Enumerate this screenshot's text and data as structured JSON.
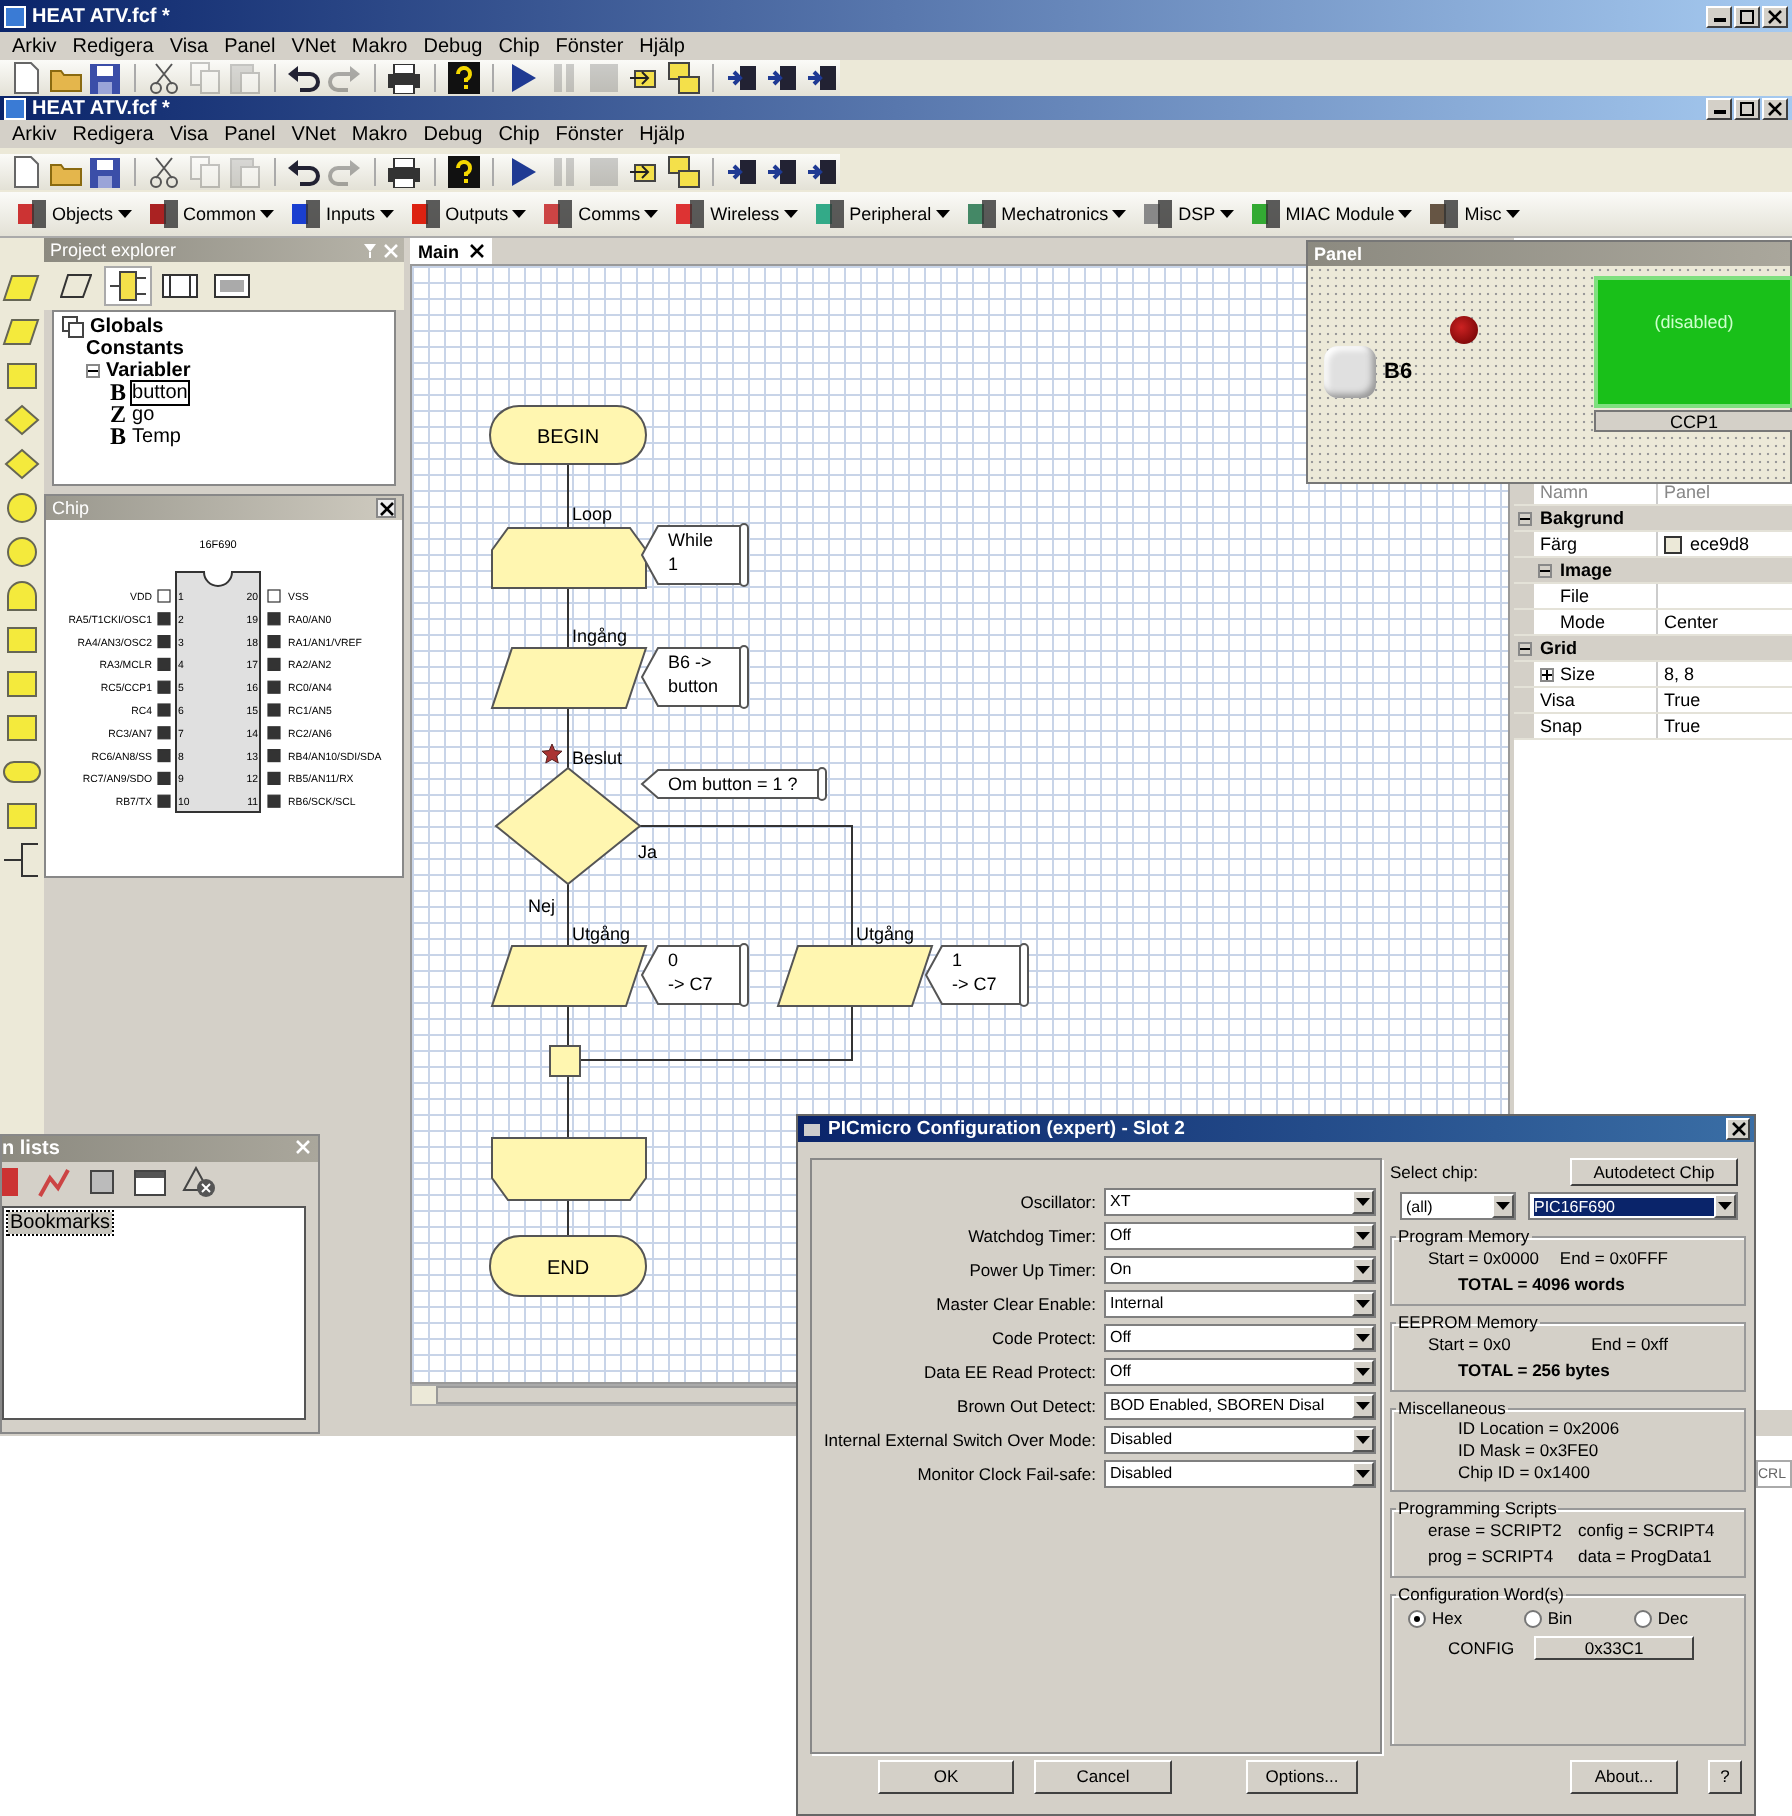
{
  "outer_window": {
    "title": "HEAT ATV.fcf *",
    "menu": [
      "Arkiv",
      "Redigera",
      "Visa",
      "Panel",
      "VNet",
      "Makro",
      "Debug",
      "Chip",
      "Fönster",
      "Hjälp"
    ],
    "toolbar": [
      [
        {
          "kind": "new",
          "disabled": false
        },
        {
          "kind": "open",
          "disabled": false
        },
        {
          "kind": "save",
          "disabled": false
        }
      ],
      [
        {
          "kind": "cut",
          "disabled": false
        },
        {
          "kind": "copy",
          "disabled": true
        },
        {
          "kind": "paste",
          "disabled": true
        }
      ],
      [
        {
          "kind": "undo",
          "disabled": false
        },
        {
          "kind": "redo",
          "disabled": true
        }
      ],
      [
        {
          "kind": "print",
          "disabled": false
        }
      ],
      [
        {
          "kind": "help",
          "disabled": false
        }
      ],
      [
        {
          "kind": "play",
          "disabled": false
        },
        {
          "kind": "pause",
          "disabled": true
        },
        {
          "kind": "stop",
          "disabled": true
        },
        {
          "kind": "step_into",
          "disabled": false
        },
        {
          "kind": "step_over",
          "disabled": false
        }
      ],
      [
        {
          "kind": "chip",
          "disabled": false
        },
        {
          "kind": "chip",
          "disabled": false
        },
        {
          "kind": "chip",
          "disabled": false
        }
      ]
    ]
  },
  "inner_window": {
    "title": "HEAT ATV.fcf *",
    "menu": [
      "Arkiv",
      "Redigera",
      "Visa",
      "Panel",
      "VNet",
      "Makro",
      "Debug",
      "Chip",
      "Fönster",
      "Hjälp"
    ],
    "toolbar": [
      [
        {
          "kind": "new",
          "disabled": false
        },
        {
          "kind": "open",
          "disabled": false
        },
        {
          "kind": "save",
          "disabled": false
        }
      ],
      [
        {
          "kind": "cut",
          "disabled": false
        },
        {
          "kind": "copy",
          "disabled": true
        },
        {
          "kind": "paste",
          "disabled": true
        }
      ],
      [
        {
          "kind": "undo",
          "disabled": false
        },
        {
          "kind": "redo",
          "disabled": true
        }
      ],
      [
        {
          "kind": "print",
          "disabled": false
        }
      ],
      [
        {
          "kind": "help",
          "disabled": false
        }
      ],
      [
        {
          "kind": "play",
          "disabled": false
        },
        {
          "kind": "pause",
          "disabled": true
        },
        {
          "kind": "stop",
          "disabled": true
        },
        {
          "kind": "step_into",
          "disabled": false
        },
        {
          "kind": "step_over",
          "disabled": false
        }
      ],
      [
        {
          "kind": "chip",
          "disabled": false
        },
        {
          "kind": "chip",
          "disabled": false
        },
        {
          "kind": "chip",
          "disabled": false
        }
      ]
    ],
    "component_toolbar": [
      "Objects",
      "Common",
      "Inputs",
      "Outputs",
      "Comms",
      "Wireless",
      "Peripheral",
      "Mechatronics",
      "DSP",
      "MIAC Module",
      "Misc"
    ]
  },
  "project_explorer": {
    "title": "Project explorer",
    "tabs": [
      {
        "kind": "io",
        "selected": false
      },
      {
        "kind": "variables",
        "selected": true
      },
      {
        "kind": "macros",
        "selected": false
      },
      {
        "kind": "components",
        "selected": false
      }
    ],
    "tree": [
      {
        "label": "Globals",
        "children": [
          {
            "label": "Constants"
          },
          {
            "label": "Variabler",
            "expanded": true,
            "children": [
              {
                "type": "B",
                "label": "button",
                "selected": true
              },
              {
                "type": "Z",
                "label": "go",
                "selected": false
              },
              {
                "type": "B",
                "label": "Temp",
                "selected": false
              }
            ]
          }
        ]
      }
    ]
  },
  "chip": {
    "title": "Chip",
    "part": "16F690",
    "left_pins": [
      {
        "number": "1",
        "label": "VDD",
        "kind": "power"
      },
      {
        "number": "2",
        "label": "RA5/T1CKI/OSC1",
        "kind": "io"
      },
      {
        "number": "3",
        "label": "RA4/AN3/OSC2",
        "kind": "io"
      },
      {
        "number": "4",
        "label": "RA3/MCLR",
        "kind": "io"
      },
      {
        "number": "5",
        "label": "RC5/CCP1",
        "kind": "io"
      },
      {
        "number": "6",
        "label": "RC4",
        "kind": "io"
      },
      {
        "number": "7",
        "label": "RC3/AN7",
        "kind": "io"
      },
      {
        "number": "8",
        "label": "RC6/AN8/SS",
        "kind": "io"
      },
      {
        "number": "9",
        "label": "RC7/AN9/SDO",
        "kind": "io"
      },
      {
        "number": "10",
        "label": "RB7/TX",
        "kind": "io"
      }
    ],
    "right_pins": [
      {
        "number": "20",
        "label": "VSS",
        "kind": "power"
      },
      {
        "number": "19",
        "label": "RA0/AN0",
        "kind": "io"
      },
      {
        "number": "18",
        "label": "RA1/AN1/VREF",
        "kind": "io"
      },
      {
        "number": "17",
        "label": "RA2/AN2",
        "kind": "io"
      },
      {
        "number": "16",
        "label": "RC0/AN4",
        "kind": "io"
      },
      {
        "number": "15",
        "label": "RC1/AN5",
        "kind": "io"
      },
      {
        "number": "14",
        "label": "RC2/AN6",
        "kind": "io"
      },
      {
        "number": "13",
        "label": "RB4/AN10/SDI/SDA",
        "kind": "io"
      },
      {
        "number": "12",
        "label": "RB5/AN11/RX",
        "kind": "io"
      },
      {
        "number": "11",
        "label": "RB6/SCK/SCL",
        "kind": "io"
      }
    ]
  },
  "editor_tabs": [
    {
      "label": "Main",
      "selected": true
    }
  ],
  "flowchart": {
    "nodes": [
      {
        "kind": "terminal",
        "text": "BEGIN"
      },
      {
        "kind": "loop_start",
        "label": "Loop",
        "comment": [
          "While",
          "1"
        ]
      },
      {
        "kind": "input",
        "label": "Ingång",
        "comment": [
          "B6 ->",
          "button"
        ]
      },
      {
        "kind": "decision",
        "label": "Beslut",
        "comment": [
          "Om button = 1 ?"
        ],
        "bookmarked": true,
        "yes_label": "Ja",
        "no_label": "Nej"
      },
      {
        "kind": "output",
        "label": "Utgång",
        "comment": [
          "0",
          "-> C7"
        ]
      },
      {
        "kind": "output",
        "label": "Utgång",
        "comment": [
          "1",
          "-> C7"
        ]
      },
      {
        "kind": "junction"
      },
      {
        "kind": "loop_end"
      },
      {
        "kind": "terminal",
        "text": "END"
      }
    ]
  },
  "panel_window": {
    "title": "Panel",
    "switch_label": "B6",
    "pressed": false,
    "display_text": "(disabled)",
    "display_caption": "CCP1"
  },
  "properties": {
    "columns": [
      "Namn",
      "Panel"
    ],
    "groups": [
      {
        "name": "Bakgrund",
        "expanded": true,
        "children": [
          {
            "name": "Färg",
            "value": "ece9d8"
          },
          {
            "name": "Image",
            "expanded": true,
            "children": [
              {
                "name": "File"
              },
              {
                "name": "Mode",
                "value": "Center"
              }
            ]
          }
        ]
      },
      {
        "name": "Grid",
        "expanded": true,
        "children": [
          {
            "name": "Size",
            "value": "8, 8",
            "expanded": false
          },
          {
            "name": "Visa",
            "value": "True"
          },
          {
            "name": "Snap",
            "value": "True"
          }
        ]
      }
    ]
  },
  "lists_panel": {
    "title": "n lists",
    "items": [
      {
        "label": "Bookmarks",
        "selected": true
      }
    ]
  },
  "status_bar": {
    "indicator": "CRL"
  },
  "dialog": {
    "title": "PICmicro Configuration (expert) - Slot 2",
    "settings": [
      {
        "label": "Oscillator:",
        "value": "XT"
      },
      {
        "label": "Watchdog Timer:",
        "value": "Off"
      },
      {
        "label": "Power Up Timer:",
        "value": "On"
      },
      {
        "label": "Master Clear Enable:",
        "value": "Internal"
      },
      {
        "label": "Code Protect:",
        "value": "Off"
      },
      {
        "label": "Data EE Read Protect:",
        "value": "Off"
      },
      {
        "label": "Brown Out Detect:",
        "value": "BOD Enabled, SBOREN Disal"
      },
      {
        "label": "Internal External Switch Over Mode:",
        "value": "Disabled"
      },
      {
        "label": "Monitor Clock Fail-safe:",
        "value": "Disabled"
      }
    ],
    "select_chip_label": "Select chip:",
    "autodetect_button": "Autodetect Chip",
    "family": "(all)",
    "chip": {
      "value": "PIC16F690",
      "focused": true
    },
    "program_memory": {
      "title": "Program Memory",
      "start": "Start = 0x0000",
      "end": "End = 0x0FFF",
      "total": "TOTAL = 4096 words"
    },
    "eeprom_memory": {
      "title": "EEPROM Memory",
      "start": "Start = 0x0",
      "end": "End = 0xff",
      "total": "TOTAL = 256 bytes"
    },
    "miscellaneous": {
      "title": "Miscellaneous",
      "lines": [
        "ID Location = 0x2006",
        "ID Mask = 0x3FE0",
        "Chip ID = 0x1400"
      ]
    },
    "programming_scripts": {
      "title": "Programming Scripts",
      "entries": [
        "erase = SCRIPT2",
        "config = SCRIPT4",
        "prog = SCRIPT4",
        "data = ProgData1"
      ]
    },
    "configuration_words": {
      "title": "Configuration Word(s)",
      "formats": [
        {
          "label": "Hex",
          "selected": true
        },
        {
          "label": "Bin",
          "selected": false
        },
        {
          "label": "Dec",
          "selected": false
        }
      ],
      "config_label": "CONFIG",
      "config_value": "0x33C1"
    },
    "buttons": [
      "OK",
      "Cancel",
      "Options...",
      "About...",
      "?"
    ]
  }
}
